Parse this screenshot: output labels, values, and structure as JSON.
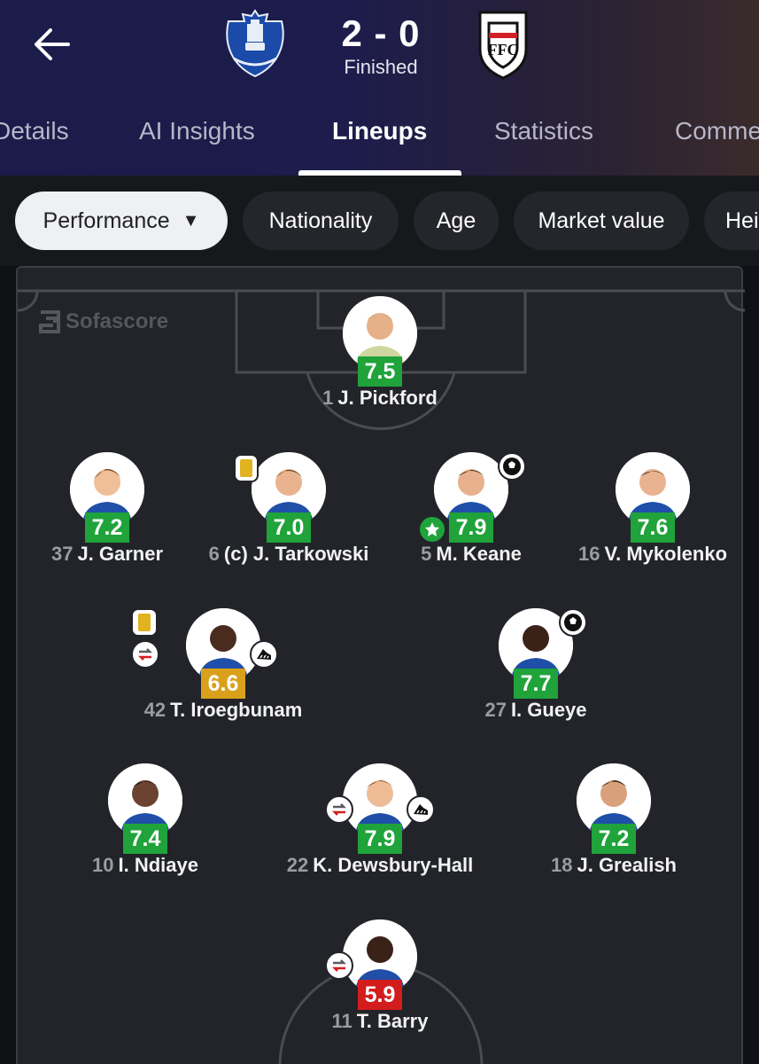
{
  "match": {
    "home_team": "Everton",
    "away_team": "Fulham",
    "score": "2 - 0",
    "status": "Finished"
  },
  "tabs": [
    {
      "label": "Details"
    },
    {
      "label": "AI Insights"
    },
    {
      "label": "Lineups",
      "active": true
    },
    {
      "label": "Statistics"
    },
    {
      "label": "Comme"
    }
  ],
  "filters": [
    {
      "label": "Performance",
      "selected": true
    },
    {
      "label": "Nationality"
    },
    {
      "label": "Age"
    },
    {
      "label": "Market value"
    },
    {
      "label": "Hei"
    }
  ],
  "watermark": "Sofascore",
  "players": [
    {
      "number": "1",
      "name": "J. Pickford",
      "rating": "7.5",
      "rating_color": "green"
    },
    {
      "number": "37",
      "name": "J. Garner",
      "rating": "7.2",
      "rating_color": "green"
    },
    {
      "number": "6",
      "name": "(c) J. Tarkowski",
      "rating": "7.0",
      "rating_color": "green",
      "badges": [
        "yellow-card"
      ]
    },
    {
      "number": "5",
      "name": "M. Keane",
      "rating": "7.9",
      "rating_color": "green",
      "badges": [
        "goal",
        "player-of-match"
      ]
    },
    {
      "number": "16",
      "name": "V. Mykolenko",
      "rating": "7.6",
      "rating_color": "green"
    },
    {
      "number": "42",
      "name": "T. Iroegbunam",
      "rating": "6.6",
      "rating_color": "amber",
      "badges": [
        "yellow-card",
        "substitution",
        "assist"
      ]
    },
    {
      "number": "27",
      "name": "I. Gueye",
      "rating": "7.7",
      "rating_color": "green",
      "badges": [
        "goal"
      ]
    },
    {
      "number": "10",
      "name": "I. Ndiaye",
      "rating": "7.4",
      "rating_color": "green"
    },
    {
      "number": "22",
      "name": "K. Dewsbury-Hall",
      "rating": "7.9",
      "rating_color": "green",
      "badges": [
        "substitution",
        "assist"
      ]
    },
    {
      "number": "18",
      "name": "J. Grealish",
      "rating": "7.2",
      "rating_color": "green"
    },
    {
      "number": "11",
      "name": "T. Barry",
      "rating": "5.9",
      "rating_color": "red",
      "badges": [
        "substitution"
      ]
    }
  ],
  "colors": {
    "rating_green": "#1fa33a",
    "rating_amber": "#d9a11b",
    "rating_red": "#d31d1d",
    "header_bg": "#1b1c4a",
    "pitch_bg": "#22242a"
  }
}
